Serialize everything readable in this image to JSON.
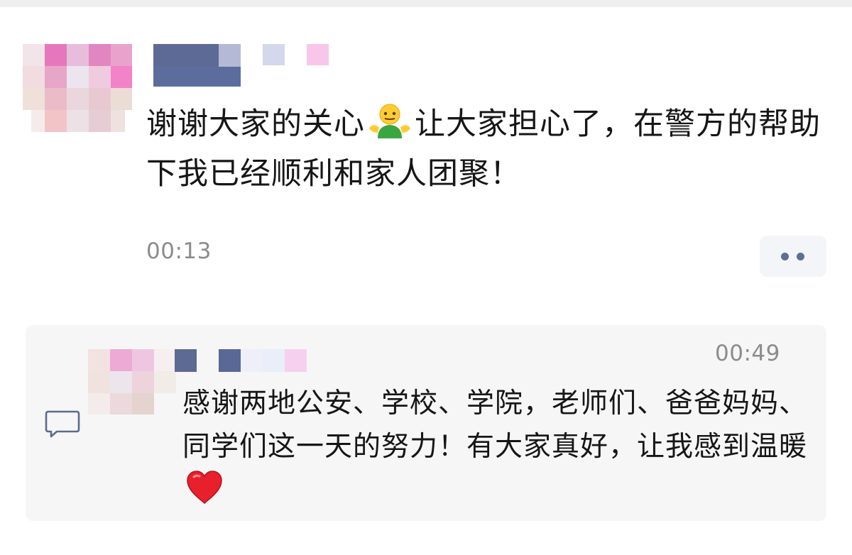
{
  "post": {
    "text_part1": "谢谢大家的关心",
    "text_emoji": "person-shrug-emoji",
    "text_part2": "让大家担心了，在警方的帮助下我已经顺利和家人团聚！",
    "time": "00:13",
    "more_icon": "more-dots-icon"
  },
  "comment": {
    "time": "00:49",
    "text": "感谢两地公安、学校、学院，老师们、爸爸妈妈、同学们这一天的努力！有大家真好，让我感到温暖",
    "text_emoji": "red-heart-emoji",
    "icon": "comment-bubble-icon"
  },
  "colors": {
    "text": "#161616",
    "time": "#8c8c8c",
    "dots": "#5d6f93",
    "card": "#f6f6f6",
    "icon": "#5a6b8f"
  }
}
